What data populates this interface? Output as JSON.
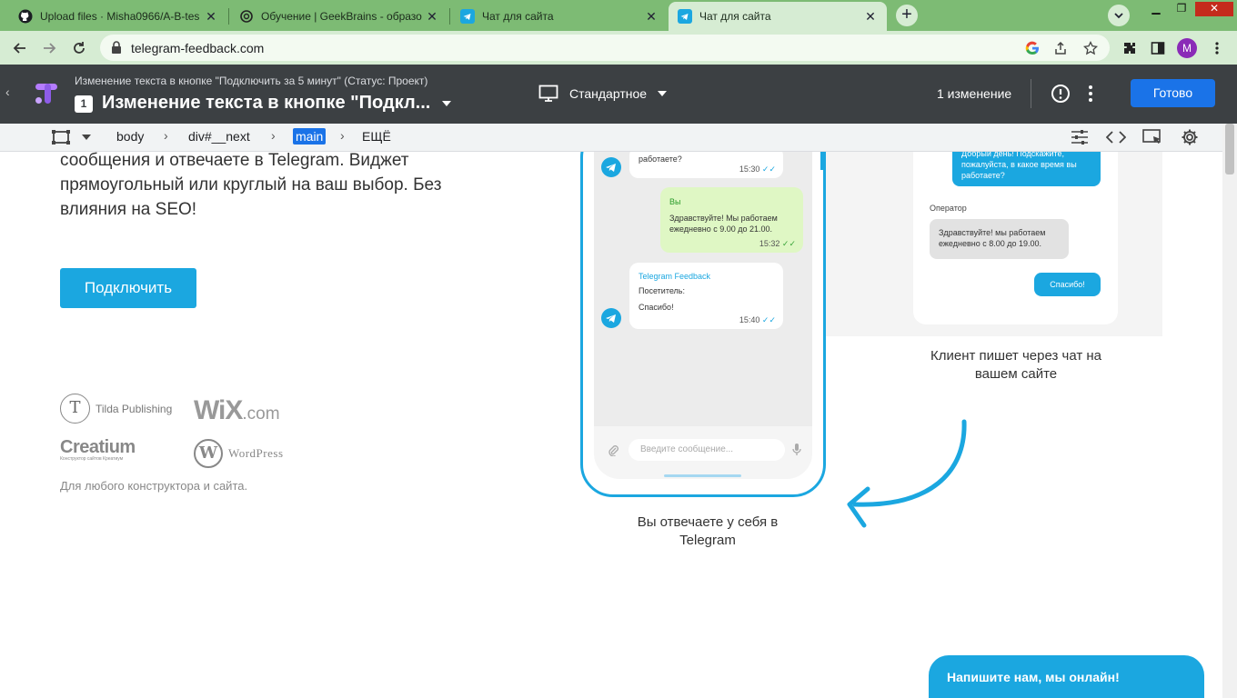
{
  "browser": {
    "tabs": [
      {
        "title": "Upload files · Misha0966/A-B-tes",
        "icon": "github-icon"
      },
      {
        "title": "Обучение | GeekBrains - образо",
        "icon": "openai-icon"
      },
      {
        "title": "Чат для сайта",
        "icon": "telegram-icon"
      },
      {
        "title": "Чат для сайта",
        "icon": "telegram-icon",
        "active": true
      }
    ],
    "url": "telegram-feedback.com",
    "profile_initial": "M",
    "theme_color": "#7dbb74"
  },
  "optimize": {
    "subtitle": "Изменение текста в кнопке \"Подключить за 5 минут\" (Статус: Проект)",
    "variant_number": "1",
    "title": "Изменение текста в кнопке \"Подкл...",
    "device_label": "Стандартное",
    "changes_label": "1 изменение",
    "done_label": "Готово"
  },
  "element_toolbar": {
    "breadcrumbs": [
      "body",
      "div#__next",
      "main",
      "ЕЩЁ"
    ],
    "selected_index": 2
  },
  "page": {
    "lead_text": "сообщения и отвечаете в Telegram. Виджет прямоугольный или круглый на ваш выбор. Без влияния на SEO!",
    "cta_label": "Подключить",
    "logos": {
      "tilda": "Tilda Publishing",
      "wix": "WiX",
      "wix_suffix": ".com",
      "creatium": "Creatium",
      "creatium_sub": "Конструктор сайтов Креатиум",
      "wordpress": "WordPress"
    },
    "logos_caption": "Для любого конструктора и сайта.",
    "phone_chat": {
      "msg1_text": "работаете?",
      "msg1_time": "15:30",
      "msg2_sender": "Вы",
      "msg2_text": "Здравствуйте! Мы работаем ежедневно с 9.00 до 21.00.",
      "msg2_time": "15:32",
      "msg3_sender": "Telegram Feedback",
      "msg3_line1": "Посетитель:",
      "msg3_line2": "Спасибо!",
      "msg3_time": "15:40",
      "input_placeholder": "Введите сообщение..."
    },
    "phone_caption": "Вы отвечаете у себя в Telegram",
    "site_chat": {
      "visitor_text": "Добрый день! Подскажите, пожалуйста, в какое время вы работаете?",
      "operator_label": "Оператор",
      "operator_text": "Здравствуйте! мы работаем ежедневно с 8.00 до 19.00.",
      "thanks_label": "Спасибо!"
    },
    "site_caption": "Клиент пишет через чат на вашем сайте",
    "chat_widget_label": "Напишите нам, мы онлайн!",
    "accent_color": "#1ba7e0"
  }
}
